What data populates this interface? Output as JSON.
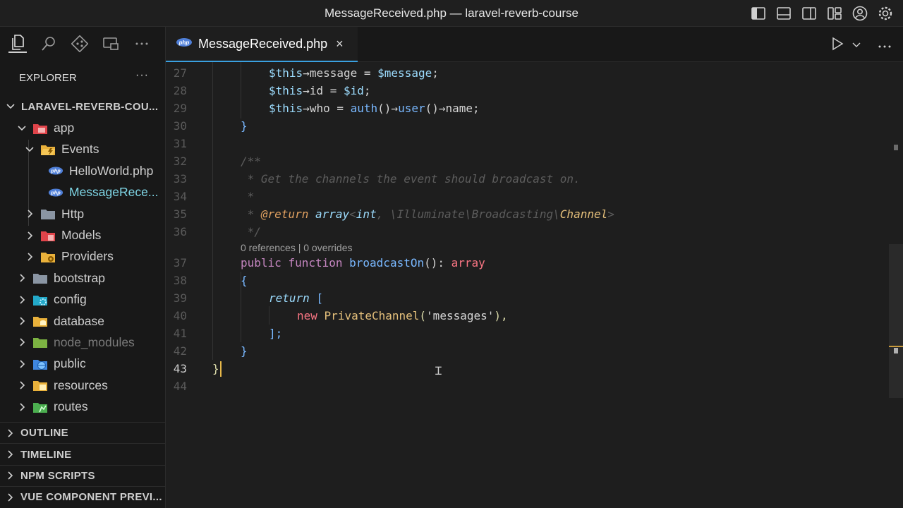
{
  "window": {
    "title": "MessageReceived.php — laravel-reverb-course"
  },
  "sidebar": {
    "header": "EXPLORER",
    "more": "···",
    "root": "LARAVEL-REVERB-COU...",
    "tree": [
      {
        "label": "app",
        "depth": 1,
        "open": true,
        "icon": "app-folder-icon"
      },
      {
        "label": "Events",
        "depth": 2,
        "open": true,
        "icon": "events-folder-icon"
      },
      {
        "label": "HelloWorld.php",
        "depth": 3,
        "icon": "php-file-icon"
      },
      {
        "label": "MessageRece...",
        "depth": 3,
        "icon": "php-file-icon",
        "selected": true
      },
      {
        "label": "Http",
        "depth": 2,
        "icon": "http-folder-icon"
      },
      {
        "label": "Models",
        "depth": 2,
        "icon": "models-folder-icon"
      },
      {
        "label": "Providers",
        "depth": 2,
        "icon": "providers-folder-icon"
      },
      {
        "label": "bootstrap",
        "depth": 1,
        "icon": "bootstrap-folder-icon"
      },
      {
        "label": "config",
        "depth": 1,
        "icon": "config-folder-icon"
      },
      {
        "label": "database",
        "depth": 1,
        "icon": "database-folder-icon"
      },
      {
        "label": "node_modules",
        "depth": 1,
        "icon": "node-modules-folder-icon",
        "dim": true
      },
      {
        "label": "public",
        "depth": 1,
        "icon": "public-folder-icon"
      },
      {
        "label": "resources",
        "depth": 1,
        "icon": "resources-folder-icon"
      },
      {
        "label": "routes",
        "depth": 1,
        "icon": "routes-folder-icon"
      }
    ],
    "panels": [
      "OUTLINE",
      "TIMELINE",
      "NPM SCRIPTS",
      "VUE COMPONENT PREVI..."
    ]
  },
  "editor": {
    "tab": {
      "name": "MessageReceived.php",
      "close": "×"
    },
    "codelens": "0 references | 0 overrides",
    "line_numbers": [
      "27",
      "28",
      "29",
      "30",
      "31",
      "32",
      "33",
      "34",
      "35",
      "36",
      "37",
      "38",
      "39",
      "40",
      "41",
      "42",
      "43",
      "44"
    ],
    "current_line": "43",
    "code": {
      "l27": {
        "a": "$this",
        "b": "→",
        "c": "message",
        "d": " = ",
        "e": "$message",
        "f": ";"
      },
      "l28": {
        "a": "$this",
        "b": "→",
        "c": "id",
        "d": " = ",
        "e": "$id",
        "f": ";"
      },
      "l29": {
        "a": "$this",
        "b": "→",
        "c": "who",
        "d": " = ",
        "e": "auth",
        "f": "()",
        "g": "→",
        "h": "user",
        "i": "()",
        "j": "→",
        "k": "name",
        "l": ";"
      },
      "l30": "}",
      "l32": "/**",
      "l33": " * Get the channels the event should broadcast on.",
      "l34": " *",
      "l35": {
        "a": " * ",
        "b": "@return",
        "c": " ",
        "d": "array",
        "e": "<",
        "f": "int",
        "g": ", \\Illuminate\\Broadcasting\\",
        "h": "Channel",
        "i": ">"
      },
      "l36": " */",
      "l37": {
        "a": "public",
        "b": " ",
        "c": "function",
        "d": " ",
        "e": "broadcastOn",
        "f": "(): ",
        "g": "array"
      },
      "l38": "{",
      "l39": {
        "a": "return",
        "b": " ["
      },
      "l40": {
        "a": "new",
        "b": " ",
        "c": "PrivateChannel",
        "d": "(",
        "e": "'messages'",
        "f": "),"
      },
      "l41": "];",
      "l42": "}",
      "l43": "}"
    }
  }
}
